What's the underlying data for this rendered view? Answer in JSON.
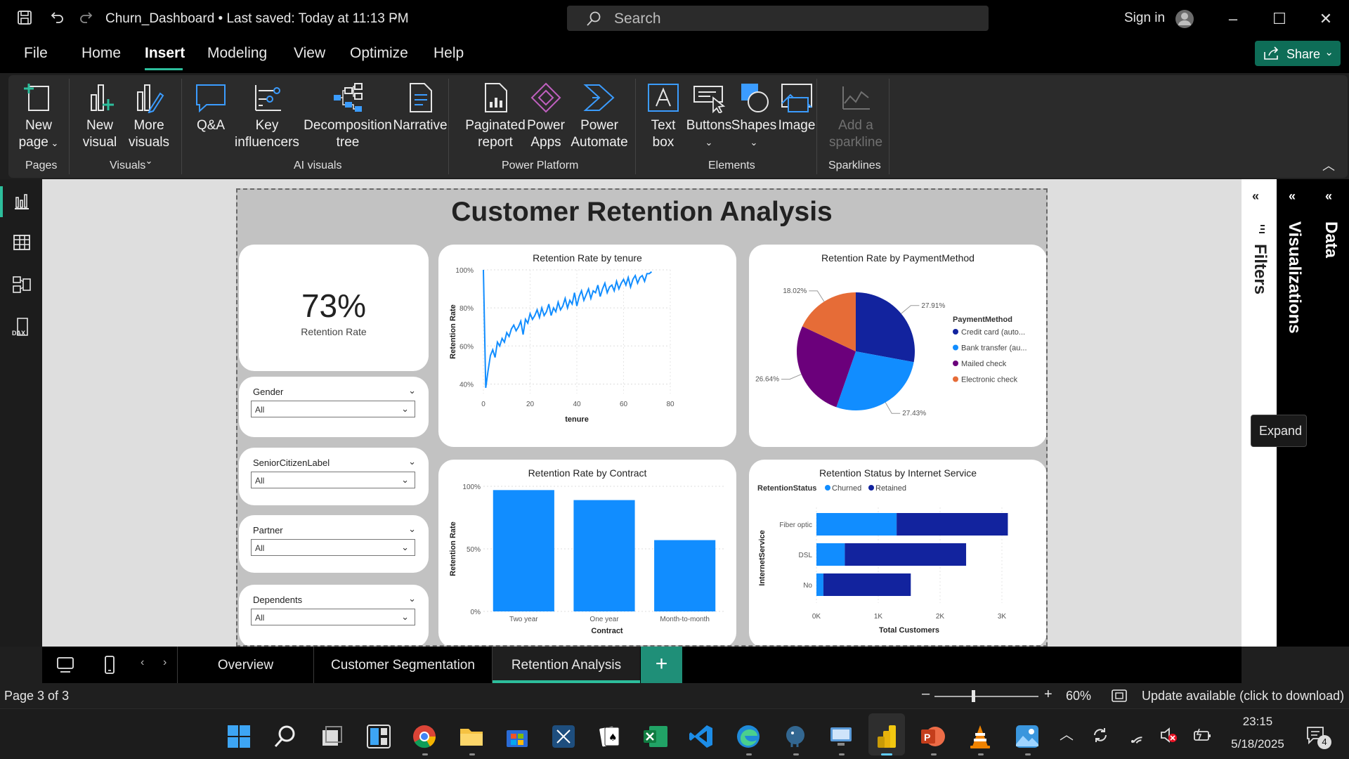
{
  "window": {
    "title": "Churn_Dashboard • Last saved: Today at 11:13 PM",
    "search_placeholder": "Search",
    "sign_in": "Sign in"
  },
  "menu": {
    "items": [
      "File",
      "Home",
      "Insert",
      "Modeling",
      "View",
      "Optimize",
      "Help"
    ],
    "active": "Insert",
    "share": "Share"
  },
  "ribbon": {
    "groups": [
      {
        "label": "Pages",
        "buttons": [
          {
            "line1": "New",
            "line2": "page"
          }
        ]
      },
      {
        "label": "Visuals",
        "buttons": [
          {
            "line1": "New",
            "line2": "visual"
          },
          {
            "line1": "More",
            "line2": "visuals"
          }
        ]
      },
      {
        "label": "AI visuals",
        "buttons": [
          {
            "line1": "Q&A",
            "line2": ""
          },
          {
            "line1": "Key",
            "line2": "influencers"
          },
          {
            "line1": "Decomposition",
            "line2": "tree"
          },
          {
            "line1": "Narrative",
            "line2": ""
          }
        ]
      },
      {
        "label": "Power Platform",
        "buttons": [
          {
            "line1": "Paginated",
            "line2": "report"
          },
          {
            "line1": "Power",
            "line2": "Apps"
          },
          {
            "line1": "Power",
            "line2": "Automate"
          }
        ]
      },
      {
        "label": "Elements",
        "buttons": [
          {
            "line1": "Text",
            "line2": "box"
          },
          {
            "line1": "Buttons",
            "line2": ""
          },
          {
            "line1": "Shapes",
            "line2": ""
          },
          {
            "line1": "Image",
            "line2": ""
          }
        ]
      },
      {
        "label": "Sparklines",
        "buttons": [
          {
            "line1": "Add a",
            "line2": "sparkline"
          }
        ]
      }
    ]
  },
  "report": {
    "title": "Customer Retention Analysis",
    "kpi": {
      "value": "73%",
      "label": "Retention Rate"
    },
    "slicers": [
      {
        "title": "Gender",
        "value": "All"
      },
      {
        "title": "SeniorCitizenLabel",
        "value": "All"
      },
      {
        "title": "Partner",
        "value": "All"
      },
      {
        "title": "Dependents",
        "value": "All"
      }
    ]
  },
  "chart_data": [
    {
      "type": "line",
      "title": "Retention Rate by tenure",
      "xlabel": "tenure",
      "ylabel": "Retention Rate",
      "xlim": [
        0,
        80
      ],
      "ylim": [
        35,
        100
      ],
      "x_ticks": [
        "0",
        "20",
        "40",
        "60",
        "80"
      ],
      "y_ticks": [
        "40%",
        "60%",
        "80%",
        "100%"
      ],
      "color": "#118dff",
      "x": [
        0,
        1,
        2,
        3,
        4,
        5,
        6,
        7,
        8,
        9,
        10,
        11,
        12,
        13,
        14,
        15,
        16,
        17,
        18,
        19,
        20,
        21,
        22,
        23,
        24,
        25,
        26,
        27,
        28,
        29,
        30,
        31,
        32,
        33,
        34,
        35,
        36,
        37,
        38,
        39,
        40,
        41,
        42,
        43,
        44,
        45,
        46,
        47,
        48,
        49,
        50,
        51,
        52,
        53,
        54,
        55,
        56,
        57,
        58,
        59,
        60,
        61,
        62,
        63,
        64,
        65,
        66,
        67,
        68,
        69,
        70,
        71,
        72
      ],
      "y": [
        100,
        38,
        47,
        55,
        58,
        54,
        62,
        60,
        64,
        62,
        67,
        65,
        69,
        71,
        68,
        70,
        73,
        66,
        74,
        72,
        77,
        74,
        76,
        79,
        75,
        80,
        76,
        78,
        82,
        76,
        80,
        78,
        83,
        79,
        81,
        85,
        80,
        84,
        82,
        88,
        81,
        86,
        89,
        84,
        87,
        90,
        85,
        89,
        88,
        92,
        86,
        90,
        93,
        88,
        91,
        92,
        89,
        94,
        90,
        93,
        95,
        92,
        96,
        91,
        95,
        97,
        93,
        96,
        97,
        94,
        98,
        98,
        99
      ]
    },
    {
      "type": "pie",
      "title": "Retention Rate by PaymentMethod",
      "legend_title": "PaymentMethod",
      "legend_position": "right",
      "slices": [
        {
          "name": "Credit card (auto...",
          "value": 27.91,
          "label": "27.91%",
          "color": "#12239e"
        },
        {
          "name": "Bank transfer (au...",
          "value": 27.43,
          "label": "27.43%",
          "color": "#118dff"
        },
        {
          "name": "Mailed check",
          "value": 26.64,
          "label": "26.64%",
          "color": "#6b007b"
        },
        {
          "name": "Electronic check",
          "value": 18.02,
          "label": "18.02%",
          "color": "#e66c37"
        }
      ]
    },
    {
      "type": "bar",
      "title": "Retention Rate by Contract",
      "xlabel": "Contract",
      "ylabel": "Retention Rate",
      "categories": [
        "Two year",
        "One year",
        "Month-to-month"
      ],
      "values": [
        97,
        89,
        57
      ],
      "ylim": [
        0,
        100
      ],
      "y_ticks": [
        "0%",
        "50%",
        "100%"
      ],
      "color": "#118dff"
    },
    {
      "type": "bar",
      "orientation": "horizontal",
      "stacked": true,
      "title": "Retention Status by Internet Service",
      "xlabel": "Total Customers",
      "ylabel": "InternetService",
      "legend_title": "RetentionStatus",
      "legend_position": "top-left",
      "categories": [
        "Fiber optic",
        "DSL",
        "No"
      ],
      "series": [
        {
          "name": "Churned",
          "values": [
            1297,
            459,
            113
          ],
          "color": "#118dff"
        },
        {
          "name": "Retained",
          "values": [
            1799,
            1962,
            1413
          ],
          "color": "#12239e"
        }
      ],
      "xlim": [
        0,
        3000
      ],
      "x_ticks": [
        "0K",
        "1K",
        "2K",
        "3K"
      ]
    }
  ],
  "panes": {
    "filters": "Filters",
    "visualizations": "Visualizations",
    "data": "Data",
    "expand_tip": "Expand"
  },
  "tabs": {
    "items": [
      "Overview",
      "Customer Segmentation",
      "Retention Analysis"
    ],
    "active": "Retention Analysis"
  },
  "status": {
    "page": "Page 3 of 3",
    "zoom": "60%",
    "update": "Update available (click to download)"
  },
  "taskbar": {
    "time": "23:15",
    "date": "5/18/2025",
    "notifications": "4"
  }
}
